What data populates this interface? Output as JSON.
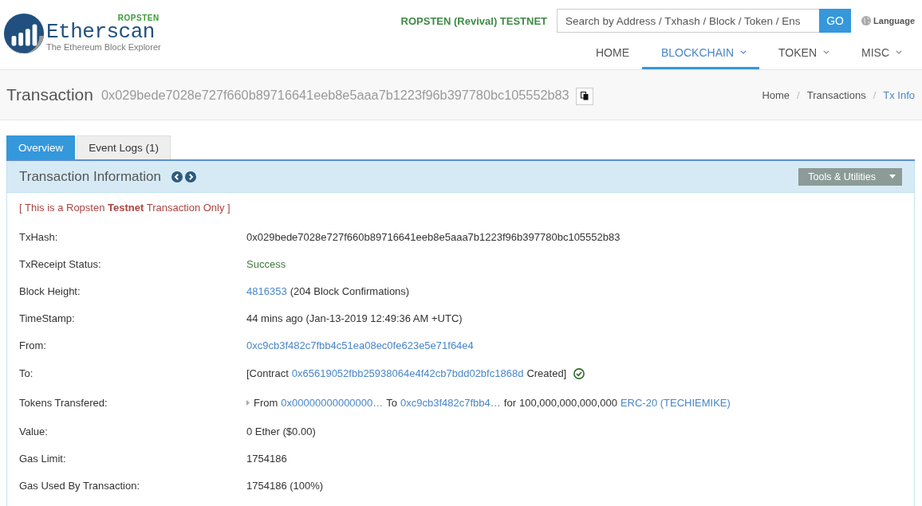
{
  "header": {
    "logo": {
      "network_tag": "ROPSTEN",
      "name": "Etherscan",
      "tagline": "The Ethereum Block Explorer"
    },
    "network_label": "ROPSTEN (Revival) TESTNET",
    "search": {
      "placeholder": "Search by Address / Txhash / Block / Token / Ens",
      "button": "GO"
    },
    "language": "Language",
    "nav": [
      {
        "label": "HOME",
        "selected": false,
        "dropdown": false
      },
      {
        "label": "BLOCKCHAIN",
        "selected": true,
        "dropdown": true
      },
      {
        "label": "TOKEN",
        "selected": false,
        "dropdown": true
      },
      {
        "label": "MISC",
        "selected": false,
        "dropdown": true
      }
    ]
  },
  "page_title": {
    "title": "Transaction",
    "hash": "0x029bede7028e727f660b89716641eeb8e5aaa7b1223f96b397780bc105552b83"
  },
  "breadcrumb": [
    {
      "label": "Home",
      "selected": false
    },
    {
      "separator": "/",
      "label": "Transactions",
      "selected": false
    },
    {
      "separator": "/",
      "label": "Tx Info",
      "selected": true
    }
  ],
  "tabs": [
    {
      "label": "Overview",
      "selected": true
    },
    {
      "label": "Event Logs (1)",
      "selected": false
    }
  ],
  "panel": {
    "title": "Transaction Information",
    "tools_button": "Tools & Utilities",
    "notice": "[ This is a Ropsten **Testnet** Transaction Only ]",
    "rows": [
      {
        "label": "TxHash:",
        "value": [
          {
            "kind": "text",
            "text": "0x029bede7028e727f660b89716641eeb8e5aaa7b1223f96b397780bc105552b83"
          }
        ]
      },
      {
        "label": "TxReceipt Status:",
        "value": [
          {
            "kind": "success",
            "text": "Success"
          }
        ]
      },
      {
        "label": "Block Height:",
        "value": [
          {
            "kind": "link",
            "text": "4816353"
          },
          {
            "kind": "text",
            "text": "(204 Block Confirmations)"
          }
        ]
      },
      {
        "label": "TimeStamp:",
        "value": [
          {
            "kind": "text",
            "text": "44 mins ago (Jan-13-2019 12:49:36 AM +UTC)"
          }
        ]
      },
      {
        "label": "From:",
        "value": [
          {
            "kind": "link",
            "text": "0xc9cb3f482c7fbb4c51ea08ec0fe623e5e71f64e4"
          }
        ]
      },
      {
        "label": "To:",
        "value": [
          {
            "kind": "text",
            "text": "[Contract"
          },
          {
            "kind": "link",
            "text": "0x65619052fbb25938064e4f42cb7bdd02bfc1868d"
          },
          {
            "kind": "text",
            "text": "Created]"
          },
          {
            "kind": "verified"
          }
        ]
      },
      {
        "label": "Tokens Transfered:",
        "value": [
          {
            "kind": "expander"
          },
          {
            "kind": "text",
            "text": "From"
          },
          {
            "kind": "link",
            "text": "0x00000000000000…"
          },
          {
            "kind": "text",
            "text": "To"
          },
          {
            "kind": "link",
            "text": "0xc9cb3f482c7fbb4…"
          },
          {
            "kind": "text",
            "text": "for"
          },
          {
            "kind": "text",
            "text": "100,000,000,000,000"
          },
          {
            "kind": "link",
            "text": "ERC-20 (TECHIEMIKE)"
          }
        ]
      },
      {
        "label": "Value:",
        "value": [
          {
            "kind": "text",
            "text": "0 Ether ($0.00)"
          }
        ]
      },
      {
        "label": "Gas Limit:",
        "value": [
          {
            "kind": "text",
            "text": "1754186"
          }
        ]
      },
      {
        "label": "Gas Used By Transaction:",
        "value": [
          {
            "kind": "text",
            "text": "1754186 (100%)"
          }
        ]
      }
    ]
  }
}
